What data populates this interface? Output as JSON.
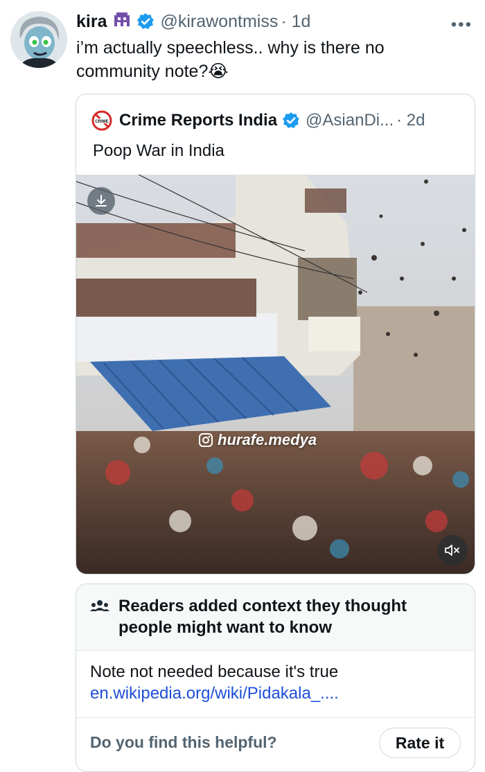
{
  "tweet": {
    "author_name": "kira",
    "author_handle": "@kirawontmiss",
    "time": "· 1d",
    "text": "i’m actually speechless.. why is there no community note?😭",
    "more_label": "•••"
  },
  "quoted": {
    "author_name": "Crime Reports India",
    "author_handle": "@AsianDi...",
    "time": "· 2d",
    "text": "Poop War in India",
    "logo_text": "CRIME",
    "watermark": "hurafe.medya"
  },
  "note": {
    "title": "Readers added context they thought people might want to know",
    "body": "Note not needed because it's true",
    "link": "en.wikipedia.org/wiki/Pidakala_....",
    "question": "Do you find this helpful?",
    "rate_label": "Rate it"
  },
  "colors": {
    "verified": "#1d9bf0",
    "secondary_text": "#536471",
    "link": "#1d4ed8",
    "border": "#cfd9de"
  }
}
